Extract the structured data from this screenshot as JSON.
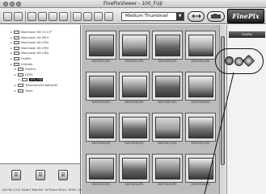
{
  "window": {
    "title": "FinePixViewer - 100_FUJI"
  },
  "toolbar": {
    "view_mode": "Medium Thumbnail"
  },
  "brand": {
    "logo": "FinePix"
  },
  "tree": {
    "items": [
      {
        "label": "Macintosh HD (3:1 JP",
        "indent": 2,
        "kind": "folder"
      },
      {
        "label": "Macintosh HD JPEG",
        "indent": 2,
        "kind": "folder"
      },
      {
        "label": "Macintosh HD (FM)",
        "indent": 2,
        "kind": "folder"
      },
      {
        "label": "Macintosh HD (FM)",
        "indent": 2,
        "kind": "folder"
      },
      {
        "label": "Macintosh HD (GB)",
        "indent": 2,
        "kind": "folder"
      },
      {
        "label": "FinePix",
        "indent": 2,
        "kind": "folder"
      },
      {
        "label": "Untitled",
        "indent": 2,
        "kind": "folder"
      },
      {
        "label": "Folders",
        "indent": 3,
        "kind": "folder"
      },
      {
        "label": "DCIM",
        "indent": 3,
        "kind": "folder"
      },
      {
        "label": "100_FUJI",
        "indent": 4,
        "kind": "folder",
        "selected": true
      },
      {
        "label": "TemporaryScrapFolder",
        "indent": 3,
        "kind": "folder"
      },
      {
        "label": "Trash",
        "indent": 3,
        "kind": "folder"
      }
    ]
  },
  "status": {
    "text": "118 File (1112 Folder)  Total file: 14 Picture  Drive / DCIM / 100_FUJI"
  },
  "thumbnails": [
    {
      "caption": "DSCF0001.JPG",
      "tone": "#7b7b7b"
    },
    {
      "caption": "DSCF0002.JPG",
      "tone": "#9c9c9c"
    },
    {
      "caption": "DSCF0003.JPG",
      "tone": "#686868"
    },
    {
      "caption": "DSCF0004.JPG",
      "tone": "#a8a8a8"
    },
    {
      "caption": "DSCF0005.JPG",
      "tone": "#6f6f6f"
    },
    {
      "caption": "DSCF0006.JPG",
      "tone": "#8c8c8c"
    },
    {
      "caption": "DSCF0007.JPG",
      "tone": "#5e5e5e"
    },
    {
      "caption": "DSCF0008.JPG",
      "tone": "#979797"
    },
    {
      "caption": "DSCF0009.JPG",
      "tone": "#818181"
    },
    {
      "caption": "DSCF0010.JPG",
      "tone": "#6a6a6a"
    },
    {
      "caption": "DSCF0011.JPG",
      "tone": "#a2a2a2"
    },
    {
      "caption": "DSCF0012.JPG",
      "tone": "#777777"
    },
    {
      "caption": "DSCF0013.JPG",
      "tone": "#909090"
    },
    {
      "caption": "DSCF0014.JPG",
      "tone": "#656565"
    },
    {
      "caption": "DSCF0015.JPG",
      "tone": "#858585"
    },
    {
      "caption": "DSCF0016.JPG",
      "tone": "#7e7e7e"
    }
  ],
  "right_panel": {
    "header": "FinePix"
  }
}
